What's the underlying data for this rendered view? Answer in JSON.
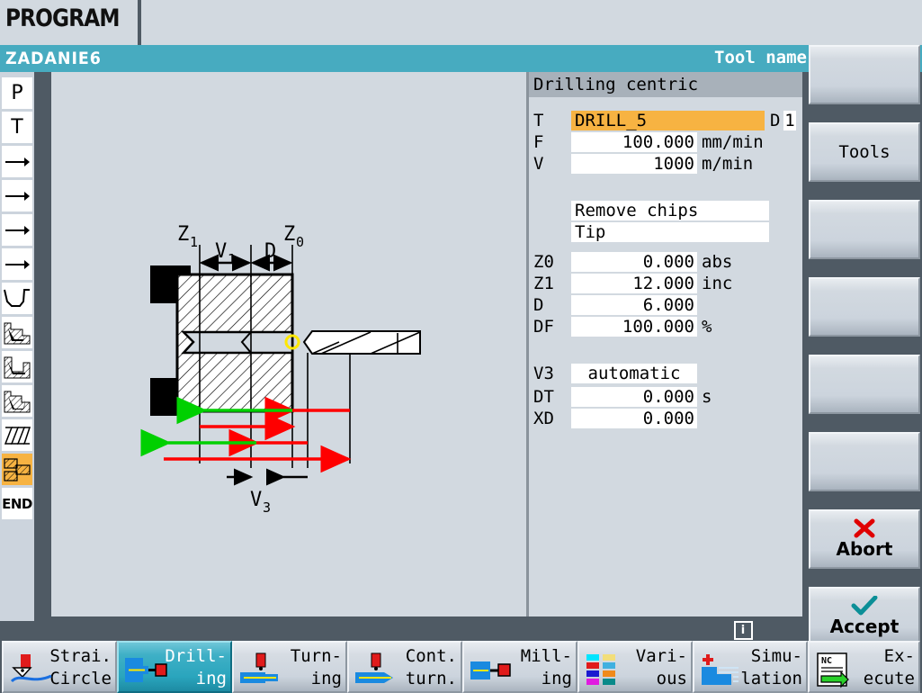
{
  "window": {
    "app_title": "PROGRAM",
    "program_name": "ZADANIE6",
    "header_right": "Tool name"
  },
  "left_rail": {
    "items": [
      {
        "name": "rail-item-p",
        "label": "P",
        "icon": "letter-p-icon",
        "selected": false
      },
      {
        "name": "rail-item-t",
        "label": "T",
        "icon": "letter-t-icon",
        "selected": false
      },
      {
        "name": "rail-item-arrow-1",
        "label": "",
        "icon": "arrow-right-icon",
        "selected": false
      },
      {
        "name": "rail-item-arrow-2",
        "label": "",
        "icon": "arrow-right-icon",
        "selected": false
      },
      {
        "name": "rail-item-arrow-3",
        "label": "",
        "icon": "arrow-right-icon",
        "selected": false
      },
      {
        "name": "rail-item-arrow-4",
        "label": "",
        "icon": "arrow-right-icon",
        "selected": false
      },
      {
        "name": "rail-item-groove",
        "label": "",
        "icon": "groove-contour-icon",
        "selected": false
      },
      {
        "name": "rail-item-rough-1",
        "label": "",
        "icon": "roughing-cut-icon",
        "selected": false
      },
      {
        "name": "rail-item-rough-2",
        "label": "",
        "icon": "roughing-cut-icon",
        "selected": false
      },
      {
        "name": "rail-item-rough-3",
        "label": "",
        "icon": "roughing-cut-icon",
        "selected": false
      },
      {
        "name": "rail-item-thread",
        "label": "",
        "icon": "thread-icon",
        "selected": false
      },
      {
        "name": "rail-item-drilling",
        "label": "",
        "icon": "drilling-centric-icon",
        "selected": true
      },
      {
        "name": "rail-item-end",
        "label": "END",
        "icon": "end-marker-icon",
        "selected": false
      }
    ]
  },
  "parameters": {
    "panel_title": "Drilling centric",
    "tool": {
      "label": "T",
      "value": "DRILL_5",
      "d_label": "D",
      "d_value": "1"
    },
    "rows": [
      {
        "label": "F",
        "value": "100.000",
        "unit": "mm/min",
        "align": "right",
        "highlight": false
      },
      {
        "label": "V",
        "value": "1000",
        "unit": "m/min",
        "align": "right",
        "highlight": false
      }
    ],
    "mode_fields": [
      {
        "label": "",
        "value": "Remove chips",
        "align": "left"
      },
      {
        "label": "",
        "value": "Tip",
        "align": "left"
      }
    ],
    "geometry": [
      {
        "label": "Z0",
        "value": "0.000",
        "unit": "abs"
      },
      {
        "label": "Z1",
        "value": "12.000",
        "unit": "inc"
      },
      {
        "label": "D",
        "value": "6.000",
        "unit": ""
      },
      {
        "label": "DF",
        "value": "100.000",
        "unit": "%"
      }
    ],
    "retract": [
      {
        "label": "V3",
        "value": "automatic",
        "unit": "",
        "align": "center"
      },
      {
        "label": "DT",
        "value": "0.000",
        "unit": "s",
        "align": "right"
      },
      {
        "label": "XD",
        "value": "0.000",
        "unit": "",
        "align": "right"
      }
    ]
  },
  "diagram": {
    "labels": {
      "z1": "Z",
      "z1_sub": "1",
      "z0": "Z",
      "z0_sub": "0",
      "v1": "V",
      "v1_sub": "1",
      "d": "D",
      "v3": "V",
      "v3_sub": "3"
    },
    "colors": {
      "feed_in": "#ff0000",
      "retract": "#00d000",
      "workpiece_line": "#000000",
      "marker": "#ffe800"
    }
  },
  "vertical_softkeys": [
    {
      "name": "vkey-1",
      "label": "",
      "icon": ""
    },
    {
      "name": "vkey-tools",
      "label": "Tools",
      "icon": ""
    },
    {
      "name": "vkey-3",
      "label": "",
      "icon": ""
    },
    {
      "name": "vkey-4",
      "label": "",
      "icon": ""
    },
    {
      "name": "vkey-5",
      "label": "",
      "icon": ""
    },
    {
      "name": "vkey-6",
      "label": "",
      "icon": ""
    },
    {
      "name": "vkey-abort",
      "label": "Abort",
      "icon": "red-x-icon"
    },
    {
      "name": "vkey-accept",
      "label": "Accept",
      "icon": "teal-check-icon"
    }
  ],
  "info_button": {
    "glyph": "i"
  },
  "bottom_softkeys": [
    {
      "name": "softkey-straight-circle",
      "line1": "Strai.",
      "line2": "Circle",
      "icon": "contour-tool-icon",
      "active": false
    },
    {
      "name": "softkey-drilling",
      "line1": "Drill-",
      "line2": "ing",
      "icon": "drilling-icon",
      "active": true
    },
    {
      "name": "softkey-turning",
      "line1": "Turn-",
      "line2": "ing",
      "icon": "turning-icon",
      "active": false
    },
    {
      "name": "softkey-cont-turn",
      "line1": "Cont.",
      "line2": "turn.",
      "icon": "contour-turning-icon",
      "active": false
    },
    {
      "name": "softkey-milling",
      "line1": "Mill-",
      "line2": "ing",
      "icon": "milling-icon",
      "active": false
    },
    {
      "name": "softkey-various",
      "line1": "Vari-",
      "line2": "ous",
      "icon": "color-grid-icon",
      "active": false
    },
    {
      "name": "softkey-simulation",
      "line1": "Simu-",
      "line2": "lation",
      "icon": "simulation-icon",
      "active": false
    },
    {
      "name": "softkey-execute",
      "line1": "Ex-",
      "line2": "ecute",
      "icon": "nc-execute-icon",
      "active": false
    }
  ],
  "colors": {
    "accent_teal": "#47abc0",
    "panel_bg": "#d2d9e0",
    "chrome": "#4f5a64",
    "highlight_orange": "#f7b342",
    "header_gray": "#a8b1ba"
  }
}
